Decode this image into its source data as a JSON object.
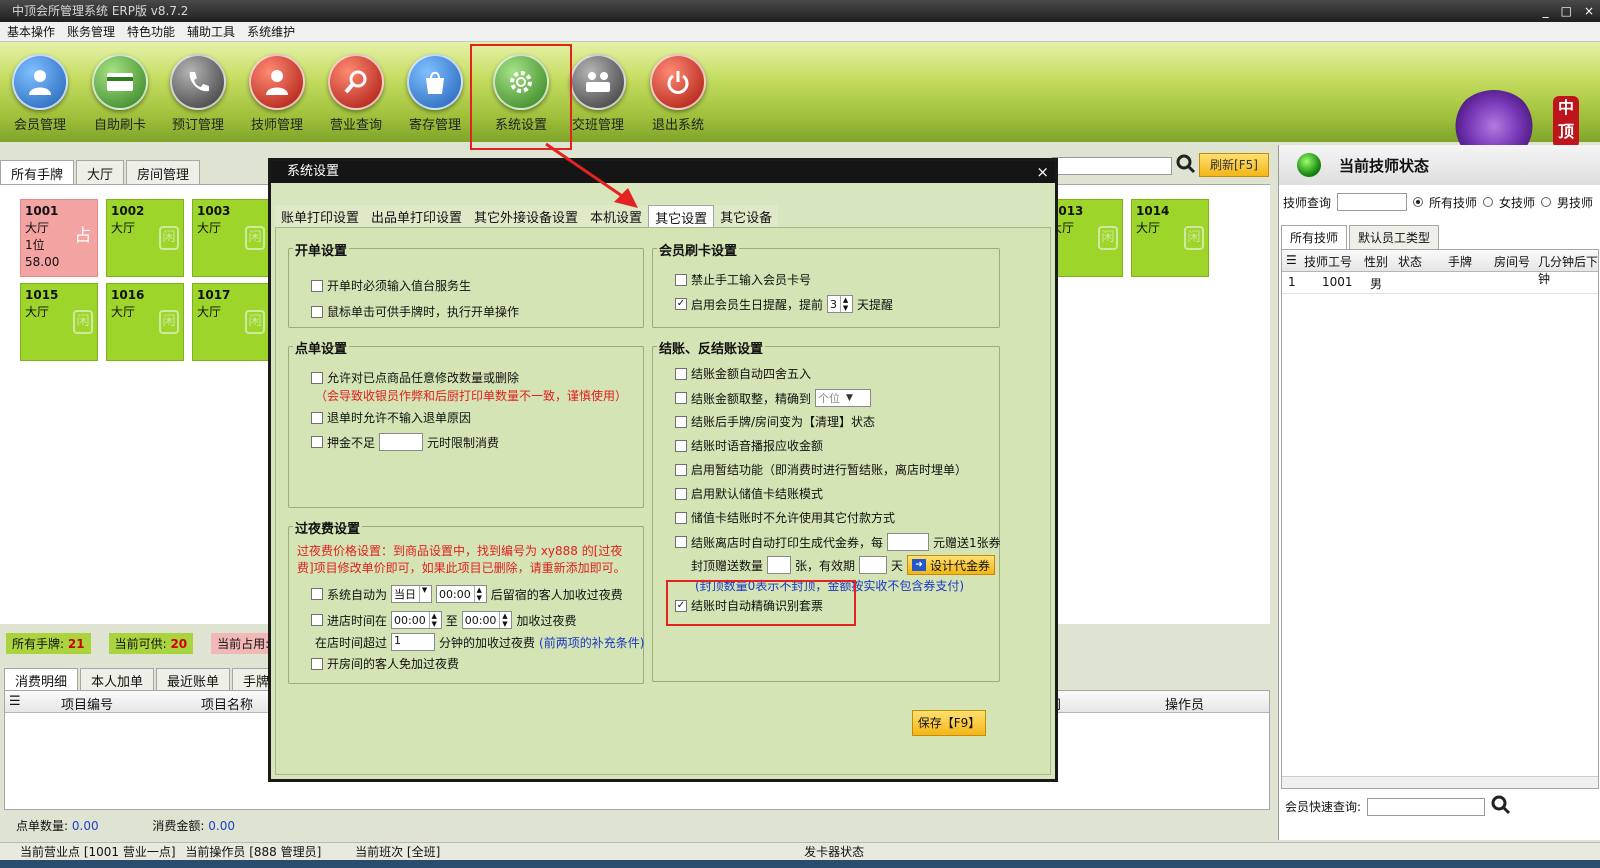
{
  "app": {
    "title": "中顶会所管理系统 ERP版 v8.7.2",
    "win_min": "_",
    "win_max": "□",
    "win_close": "×"
  },
  "menu": [
    "基本操作",
    "账务管理",
    "特色功能",
    "辅助工具",
    "系统维护"
  ],
  "toolbar": [
    {
      "label": "会员管理",
      "icon": "user-icon",
      "color": "#2f7fd2"
    },
    {
      "label": "自助刷卡",
      "icon": "card-icon",
      "color": "#3a9a2b"
    },
    {
      "label": "预订管理",
      "icon": "phone-icon",
      "color": "#555555"
    },
    {
      "label": "技师管理",
      "icon": "technician-icon",
      "color": "#d13a28"
    },
    {
      "label": "营业查询",
      "icon": "magnifier-icon",
      "color": "#d13a28"
    },
    {
      "label": "寄存管理",
      "icon": "bag-icon",
      "color": "#2f7fd2"
    },
    {
      "label": "系统设置",
      "icon": "gear-icon",
      "color": "#3a9a2b"
    },
    {
      "label": "交班管理",
      "icon": "shift-icon",
      "color": "#555555"
    },
    {
      "label": "退出系统",
      "icon": "power-icon",
      "color": "#d13a28"
    }
  ],
  "logo_text": "中顶",
  "main_tabs": [
    "所有手牌",
    "大厅",
    "房间管理"
  ],
  "refresh_label": "刷新[F5]",
  "rooms": [
    {
      "num": "1001",
      "area": "大厅",
      "extra1": "1位",
      "extra2": "58.00",
      "status": "occupied",
      "icon_text": "占"
    },
    {
      "num": "1002",
      "area": "大厅",
      "extra1": "",
      "extra2": "",
      "status": "free",
      "icon_text": "闲"
    },
    {
      "num": "1003",
      "area": "大厅",
      "extra1": "",
      "extra2": "",
      "status": "free",
      "icon_text": "闲"
    },
    {
      "num": "1013",
      "area": "大厅",
      "extra1": "",
      "extra2": "",
      "status": "free",
      "icon_text": "闲"
    },
    {
      "num": "1014",
      "area": "大厅",
      "extra1": "",
      "extra2": "",
      "status": "free",
      "icon_text": "闲"
    },
    {
      "num": "1015",
      "area": "大厅",
      "extra1": "",
      "extra2": "",
      "status": "free",
      "icon_text": "闲"
    },
    {
      "num": "1016",
      "area": "大厅",
      "extra1": "",
      "extra2": "",
      "status": "free",
      "icon_text": "闲"
    },
    {
      "num": "1017",
      "area": "大厅",
      "extra1": "",
      "extra2": "",
      "status": "free",
      "icon_text": "闲"
    }
  ],
  "stats": {
    "all_label": "所有手牌:",
    "all_val": "21",
    "avail_label": "当前可供:",
    "avail_val": "20",
    "occupied_label": "当前占用:"
  },
  "bottom_tabs": [
    "消费明细",
    "本人加单",
    "最近账单",
    "手牌"
  ],
  "detail_cols": [
    "项目编号",
    "项目名称",
    "时间",
    "操作员"
  ],
  "bottom_sum": {
    "count_label": "点单数量:",
    "count_val": "0.00",
    "amount_label": "消费金额:",
    "amount_val": "0.00"
  },
  "statusbar": {
    "point": "当前营业点 [1001 营业一点]",
    "operator": "当前操作员 [888 管理员]",
    "shift": "当前班次 [全班]",
    "card_reader": "发卡器状态"
  },
  "right": {
    "title": "当前技师状态",
    "query_label": "技师查询",
    "radios": [
      "所有技师",
      "女技师",
      "男技师"
    ],
    "tabs": [
      "所有技师",
      "默认员工类型"
    ],
    "cols": [
      "技师工号",
      "性别",
      "状态",
      "手牌",
      "房间号",
      "几分钟后下钟"
    ],
    "rows": [
      {
        "idx": "1",
        "id": "1001",
        "gender": "男"
      }
    ],
    "quick_label": "会员快速查询:"
  },
  "dialog": {
    "title": "系统设置",
    "close": "×",
    "tabs": [
      "账单打印设置",
      "出品单打印设置",
      "其它外接设备设置",
      "本机设置",
      "其它设置",
      "其它设备"
    ],
    "open": {
      "title": "开单设置",
      "opt1": "开单时必须输入值台服务生",
      "opt2": "鼠标单击可供手牌时，执行开单操作"
    },
    "order": {
      "title": "点单设置",
      "opt1": "允许对已点商品任意修改数量或删除",
      "warn": "（会导致收银员作弊和后厨打印单数量不一致，谨慎使用）",
      "opt2": "退单时允许不输入退单原因",
      "opt3a": "押金不足",
      "opt3b": "元时限制消费"
    },
    "overnight": {
      "title": "过夜费设置",
      "note": "过夜费价格设置：到商品设置中，找到编号为 xy888 的[过夜费]项目修改单价即可，如果此项目已删除，请重新添加即可。",
      "opt1a": "系统自动为",
      "opt1_day": "当日",
      "opt1_time": "00:00",
      "opt1b": "后留宿的客人加收过夜费",
      "opt2a": "进店时间在",
      "opt2_from": "00:00",
      "opt2_to_label": "至",
      "opt2_to": "00:00",
      "opt2b": "加收过夜费",
      "opt3a": "在店时间超过",
      "opt3_val": "1",
      "opt3b": "分钟的加收过夜费",
      "opt3_note": "(前两项的补充条件)",
      "opt4": "开房间的客人免加过夜费"
    },
    "member": {
      "title": "会员刷卡设置",
      "opt1": "禁止手工输入会员卡号",
      "opt2a": "启用会员生日提醒，提前",
      "opt2_val": "3",
      "opt2b": "天提醒"
    },
    "checkout": {
      "title": "结账、反结账设置",
      "opt1": "结账金额自动四舍五入",
      "opt2a": "结账金额取整，精确到",
      "opt2_sel": "个位",
      "opt3": "结账后手牌/房间变为【清理】状态",
      "opt4": "结账时语音播报应收金额",
      "opt5": "启用暂结功能（即消费时进行暂结账，离店时埋单）",
      "opt6": "启用默认储值卡结账模式",
      "opt7": "储值卡结账时不允许使用其它付款方式",
      "opt8a": "结账离店时自动打印生成代金券，每",
      "opt8b": "元赠送1张券",
      "opt9a": "封顶赠送数量",
      "opt9b": "张，有效期",
      "opt9c": "天",
      "coupon_btn": "设计代金券",
      "opt9_note": "(封顶数量0表示不封顶，金额按实收不包含券支付)",
      "opt10": "结账时自动精确识别套票"
    },
    "save": "保存【F9】"
  }
}
